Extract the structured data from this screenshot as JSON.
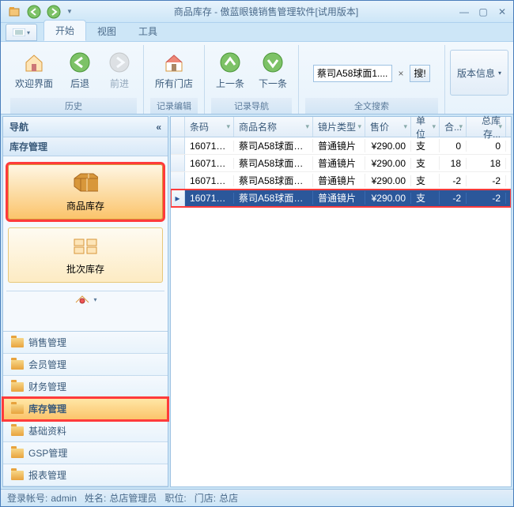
{
  "window": {
    "title": "商品库存 - 傲蓝眼镜销售管理软件[试用版本]"
  },
  "tabs": {
    "start": "开始",
    "view": "视图",
    "tools": "工具"
  },
  "ribbon": {
    "history": {
      "welcome": "欢迎界面",
      "back": "后退",
      "forward": "前进",
      "group": "历史"
    },
    "record": {
      "allStores": "所有门店",
      "group": "记录编辑"
    },
    "nav": {
      "prev": "上一条",
      "next": "下一条",
      "group": "记录导航"
    },
    "search": {
      "value": "蔡司A58球面1....",
      "button": "搜!",
      "group": "全文搜索"
    },
    "version": "版本信息"
  },
  "nav": {
    "title": "导航",
    "section": "库存管理",
    "cards": {
      "product": "商品库存",
      "batch": "批次库存"
    },
    "items": [
      "销售管理",
      "会员管理",
      "财务管理",
      "库存管理",
      "基础资料",
      "GSP管理",
      "报表管理"
    ]
  },
  "grid": {
    "columns": {
      "code": "条码",
      "name": "商品名称",
      "type": "镜片类型",
      "price": "售价",
      "unit": "单位",
      "qty": "合...",
      "total": "总库存..."
    },
    "rows": [
      {
        "code": "160714...",
        "name": "蔡司A58球面1....",
        "type": "普通镜片",
        "price": "¥290.00",
        "unit": "支",
        "qty": "0",
        "total": "0"
      },
      {
        "code": "160714...",
        "name": "蔡司A58球面1....",
        "type": "普通镜片",
        "price": "¥290.00",
        "unit": "支",
        "qty": "18",
        "total": "18"
      },
      {
        "code": "160714...",
        "name": "蔡司A58球面1....",
        "type": "普通镜片",
        "price": "¥290.00",
        "unit": "支",
        "qty": "-2",
        "total": "-2"
      },
      {
        "code": "160714...",
        "name": "蔡司A58球面1....",
        "type": "普通镜片",
        "price": "¥290.00",
        "unit": "支",
        "qty": "-2",
        "total": "-2"
      }
    ]
  },
  "status": {
    "account_label": "登录帐号:",
    "account": "admin",
    "name_label": "姓名:",
    "name": "总店管理员",
    "position_label": "职位:",
    "store_label": "门店:",
    "store": "总店"
  }
}
